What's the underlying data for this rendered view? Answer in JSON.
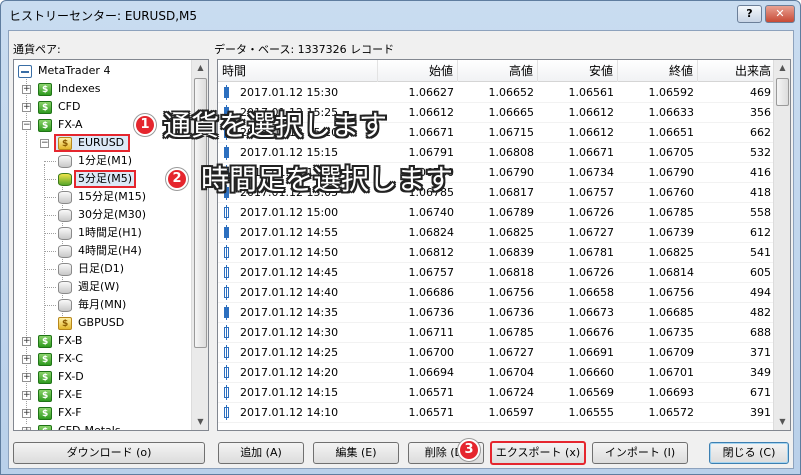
{
  "window": {
    "title": "ヒストリーセンター: EURUSD,M5",
    "help_label": "?",
    "close_label": "✕"
  },
  "labels": {
    "pairs": "通貨ペア:",
    "database": "データ・ベース: 1337326 レコード"
  },
  "tree": {
    "root": "MetaTrader 4",
    "indexes": "Indexes",
    "cfd": "CFD",
    "fxa": "FX-A",
    "eurusd": "EURUSD",
    "timeframes": [
      "1分足(M1)",
      "5分足(M5)",
      "15分足(M15)",
      "30分足(M30)",
      "1時間足(H1)",
      "4時間足(H4)",
      "日足(D1)",
      "週足(W)",
      "毎月(MN)"
    ],
    "gbpusd": "GBPUSD",
    "groups": [
      "FX-B",
      "FX-C",
      "FX-D",
      "FX-E",
      "FX-F",
      "CFD-Metals"
    ]
  },
  "table": {
    "columns": [
      "時間",
      "始値",
      "高値",
      "安値",
      "終値",
      "出来高"
    ],
    "rows": [
      [
        "2017.01.12 15:30",
        "1.06627",
        "1.06652",
        "1.06561",
        "1.06592",
        "469"
      ],
      [
        "2017.01.12 15:25",
        "1.06612",
        "1.06665",
        "1.06612",
        "1.06633",
        "356"
      ],
      [
        "2017.01.12 15:20",
        "1.06671",
        "1.06715",
        "1.06612",
        "1.06651",
        "662"
      ],
      [
        "2017.01.12 15:15",
        "1.06791",
        "1.06808",
        "1.06671",
        "1.06705",
        "532"
      ],
      [
        "2017.01.12 15:10",
        "1.06760",
        "1.06790",
        "1.06734",
        "1.06790",
        "416"
      ],
      [
        "2017.01.12 15:05",
        "1.06785",
        "1.06817",
        "1.06757",
        "1.06760",
        "418"
      ],
      [
        "2017.01.12 15:00",
        "1.06740",
        "1.06789",
        "1.06726",
        "1.06785",
        "558"
      ],
      [
        "2017.01.12 14:55",
        "1.06824",
        "1.06825",
        "1.06727",
        "1.06739",
        "612"
      ],
      [
        "2017.01.12 14:50",
        "1.06812",
        "1.06839",
        "1.06781",
        "1.06825",
        "541"
      ],
      [
        "2017.01.12 14:45",
        "1.06757",
        "1.06818",
        "1.06726",
        "1.06814",
        "605"
      ],
      [
        "2017.01.12 14:40",
        "1.06686",
        "1.06756",
        "1.06658",
        "1.06756",
        "494"
      ],
      [
        "2017.01.12 14:35",
        "1.06736",
        "1.06736",
        "1.06673",
        "1.06685",
        "482"
      ],
      [
        "2017.01.12 14:30",
        "1.06711",
        "1.06785",
        "1.06676",
        "1.06735",
        "688"
      ],
      [
        "2017.01.12 14:25",
        "1.06700",
        "1.06727",
        "1.06691",
        "1.06709",
        "371"
      ],
      [
        "2017.01.12 14:20",
        "1.06694",
        "1.06704",
        "1.06660",
        "1.06701",
        "349"
      ],
      [
        "2017.01.12 14:15",
        "1.06571",
        "1.06724",
        "1.06569",
        "1.06693",
        "671"
      ],
      [
        "2017.01.12 14:10",
        "1.06571",
        "1.06597",
        "1.06555",
        "1.06572",
        "391"
      ]
    ],
    "candle_types": [
      "bear",
      "bear",
      "bear",
      "bear",
      "bull",
      "bear",
      "bull",
      "bear",
      "bull",
      "bull",
      "bull",
      "bear",
      "bull",
      "bull",
      "bull",
      "bull",
      "bull"
    ]
  },
  "buttons": {
    "download": "ダウンロード (o)",
    "add": "追加 (A)",
    "edit": "編集 (E)",
    "delete": "削除 (D)",
    "export": "エクスポート (x)",
    "import": "インポート (I)",
    "close": "閉じる (C)"
  },
  "annotations": {
    "step1": {
      "num": "1",
      "text": "通貨を選択します"
    },
    "step2": {
      "num": "2",
      "text": "時間足を選択します"
    },
    "step3": {
      "num": "3"
    }
  },
  "colors": {
    "highlight": "#e5262e",
    "candle": "#2c6fbf"
  }
}
